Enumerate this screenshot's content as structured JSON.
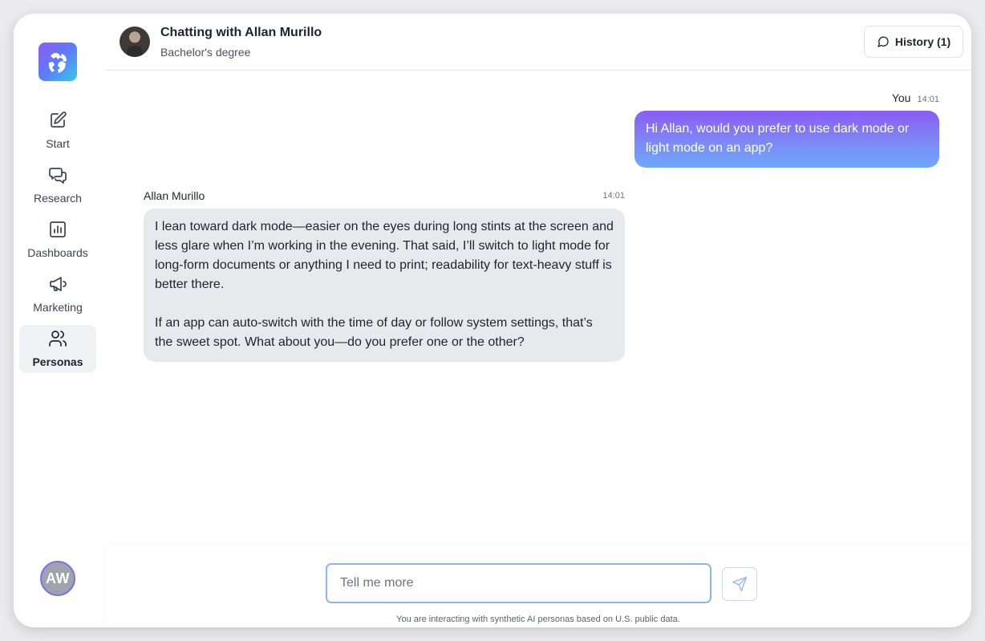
{
  "sidebar": {
    "items": [
      {
        "label": "Start",
        "icon": "edit-icon"
      },
      {
        "label": "Research",
        "icon": "chat-bubbles-icon"
      },
      {
        "label": "Dashboards",
        "icon": "bar-chart-icon"
      },
      {
        "label": "Marketing",
        "icon": "megaphone-icon"
      },
      {
        "label": "Personas",
        "icon": "users-icon",
        "active": true
      }
    ],
    "user_initials": "AW"
  },
  "header": {
    "title": "Chatting with Allan Murillo",
    "subtitle": "Bachelor's degree",
    "history_label": "History (1)"
  },
  "messages": [
    {
      "sender": "You",
      "time": "14:01",
      "text": "Hi Allan, would you prefer to use dark mode or light mode on an app?"
    },
    {
      "sender": "Allan Murillo",
      "time": "14:01",
      "paragraphs": [
        "I lean toward dark mode—easier on the eyes during long stints at the screen and less glare when I’m working in the evening. That said, I’ll switch to light mode for long-form documents or anything I need to print; readability for text-heavy stuff is better there.",
        "If an app can auto-switch with the time of day or follow system settings, that’s the sweet spot. What about you—do you prefer one or the other?"
      ]
    }
  ],
  "composer": {
    "placeholder": "Tell me more",
    "disclaimer": "You are interacting with synthetic AI personas based on U.S. public data."
  },
  "colors": {
    "accent_gradient_start": "#8a5cf5",
    "accent_gradient_end": "#6ea8fb",
    "ai_bubble": "#e8e9ed",
    "input_border": "#8fb3ef"
  }
}
